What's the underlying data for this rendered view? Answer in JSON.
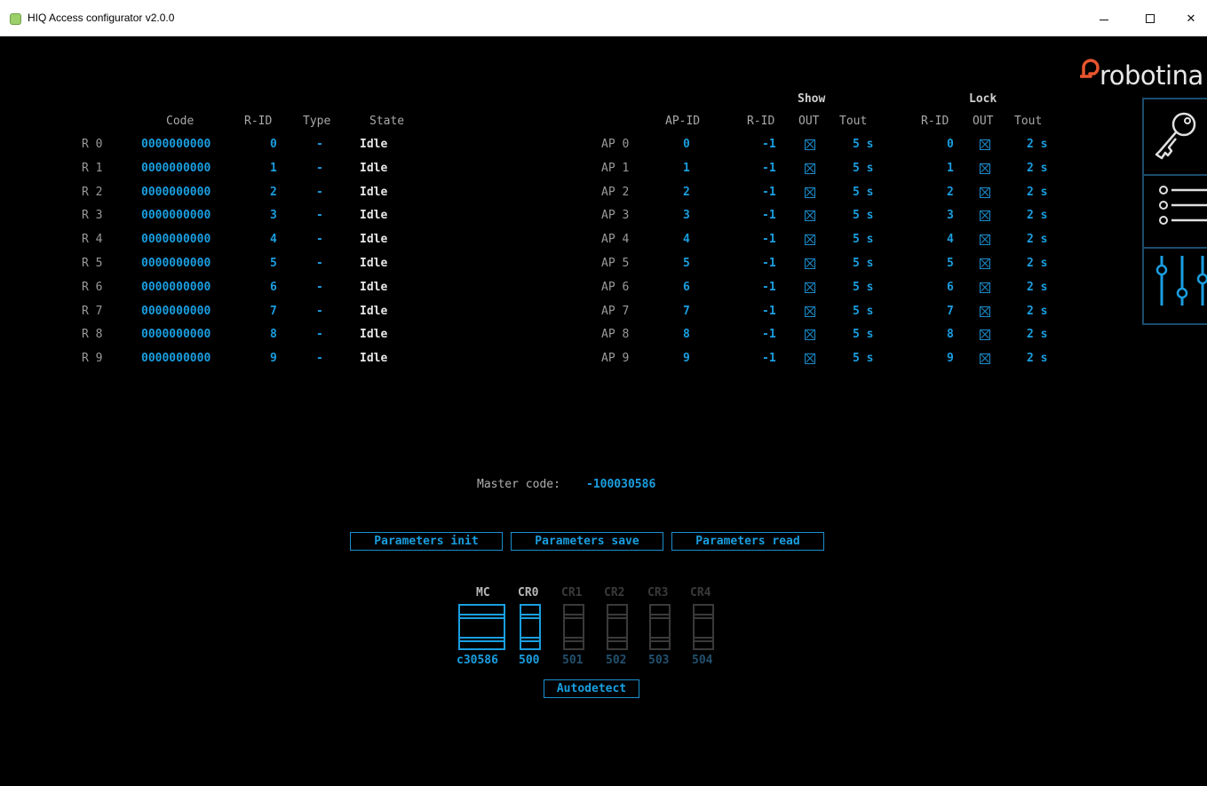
{
  "window": {
    "title": "HIQ Access configurator v2.0.0",
    "minimize_label": "–",
    "maximize_label": "",
    "close_label": "✕"
  },
  "readers_table": {
    "headers": [
      "Code",
      "R-ID",
      "Type",
      "State"
    ],
    "rows": [
      {
        "label": "R 0",
        "code": "0000000000",
        "rid": "0",
        "type": "-",
        "state": "Idle"
      },
      {
        "label": "R 1",
        "code": "0000000000",
        "rid": "1",
        "type": "-",
        "state": "Idle"
      },
      {
        "label": "R 2",
        "code": "0000000000",
        "rid": "2",
        "type": "-",
        "state": "Idle"
      },
      {
        "label": "R 3",
        "code": "0000000000",
        "rid": "3",
        "type": "-",
        "state": "Idle"
      },
      {
        "label": "R 4",
        "code": "0000000000",
        "rid": "4",
        "type": "-",
        "state": "Idle"
      },
      {
        "label": "R 5",
        "code": "0000000000",
        "rid": "5",
        "type": "-",
        "state": "Idle"
      },
      {
        "label": "R 6",
        "code": "0000000000",
        "rid": "6",
        "type": "-",
        "state": "Idle"
      },
      {
        "label": "R 7",
        "code": "0000000000",
        "rid": "7",
        "type": "-",
        "state": "Idle"
      },
      {
        "label": "R 8",
        "code": "0000000000",
        "rid": "8",
        "type": "-",
        "state": "Idle"
      },
      {
        "label": "R 9",
        "code": "0000000000",
        "rid": "9",
        "type": "-",
        "state": "Idle"
      }
    ]
  },
  "ap_table": {
    "group_show": "Show",
    "group_lock": "Lock",
    "headers": [
      "AP-ID",
      "R-ID",
      "OUT",
      "Tout",
      "R-ID",
      "OUT",
      "Tout"
    ],
    "rows": [
      {
        "label": "AP 0",
        "apid": "0",
        "show_rid": "-1",
        "show_out": true,
        "show_tout": "5 s",
        "lock_rid": "0",
        "lock_out": true,
        "lock_tout": "2 s"
      },
      {
        "label": "AP 1",
        "apid": "1",
        "show_rid": "-1",
        "show_out": true,
        "show_tout": "5 s",
        "lock_rid": "1",
        "lock_out": true,
        "lock_tout": "2 s"
      },
      {
        "label": "AP 2",
        "apid": "2",
        "show_rid": "-1",
        "show_out": true,
        "show_tout": "5 s",
        "lock_rid": "2",
        "lock_out": true,
        "lock_tout": "2 s"
      },
      {
        "label": "AP 3",
        "apid": "3",
        "show_rid": "-1",
        "show_out": true,
        "show_tout": "5 s",
        "lock_rid": "3",
        "lock_out": true,
        "lock_tout": "2 s"
      },
      {
        "label": "AP 4",
        "apid": "4",
        "show_rid": "-1",
        "show_out": true,
        "show_tout": "5 s",
        "lock_rid": "4",
        "lock_out": true,
        "lock_tout": "2 s"
      },
      {
        "label": "AP 5",
        "apid": "5",
        "show_rid": "-1",
        "show_out": true,
        "show_tout": "5 s",
        "lock_rid": "5",
        "lock_out": true,
        "lock_tout": "2 s"
      },
      {
        "label": "AP 6",
        "apid": "6",
        "show_rid": "-1",
        "show_out": true,
        "show_tout": "5 s",
        "lock_rid": "6",
        "lock_out": true,
        "lock_tout": "2 s"
      },
      {
        "label": "AP 7",
        "apid": "7",
        "show_rid": "-1",
        "show_out": true,
        "show_tout": "5 s",
        "lock_rid": "7",
        "lock_out": true,
        "lock_tout": "2 s"
      },
      {
        "label": "AP 8",
        "apid": "8",
        "show_rid": "-1",
        "show_out": true,
        "show_tout": "5 s",
        "lock_rid": "8",
        "lock_out": true,
        "lock_tout": "2 s"
      },
      {
        "label": "AP 9",
        "apid": "9",
        "show_rid": "-1",
        "show_out": true,
        "show_tout": "5 s",
        "lock_rid": "9",
        "lock_out": true,
        "lock_tout": "2 s"
      }
    ]
  },
  "master": {
    "label": "Master code:",
    "value": "-100030586"
  },
  "buttons": {
    "init": "Parameters init",
    "save": "Parameters save",
    "read": "Parameters read",
    "autodetect": "Autodetect"
  },
  "modules": [
    {
      "name": "MC",
      "value": "c30586",
      "active": true
    },
    {
      "name": "CR0",
      "value": "500",
      "active": true
    },
    {
      "name": "CR1",
      "value": "501",
      "active": false
    },
    {
      "name": "CR2",
      "value": "502",
      "active": false
    },
    {
      "name": "CR3",
      "value": "503",
      "active": false
    },
    {
      "name": "CR4",
      "value": "504",
      "active": false
    }
  ],
  "branding": {
    "logo_text": "robotina"
  },
  "sidebar": [
    {
      "icon": "key-icon"
    },
    {
      "icon": "list-icon"
    },
    {
      "icon": "sliders-icon"
    }
  ],
  "colors": {
    "accent": "#1a9ee0",
    "logo": "#e8552d",
    "background": "#000000",
    "inactive": "#3a3a3a"
  }
}
